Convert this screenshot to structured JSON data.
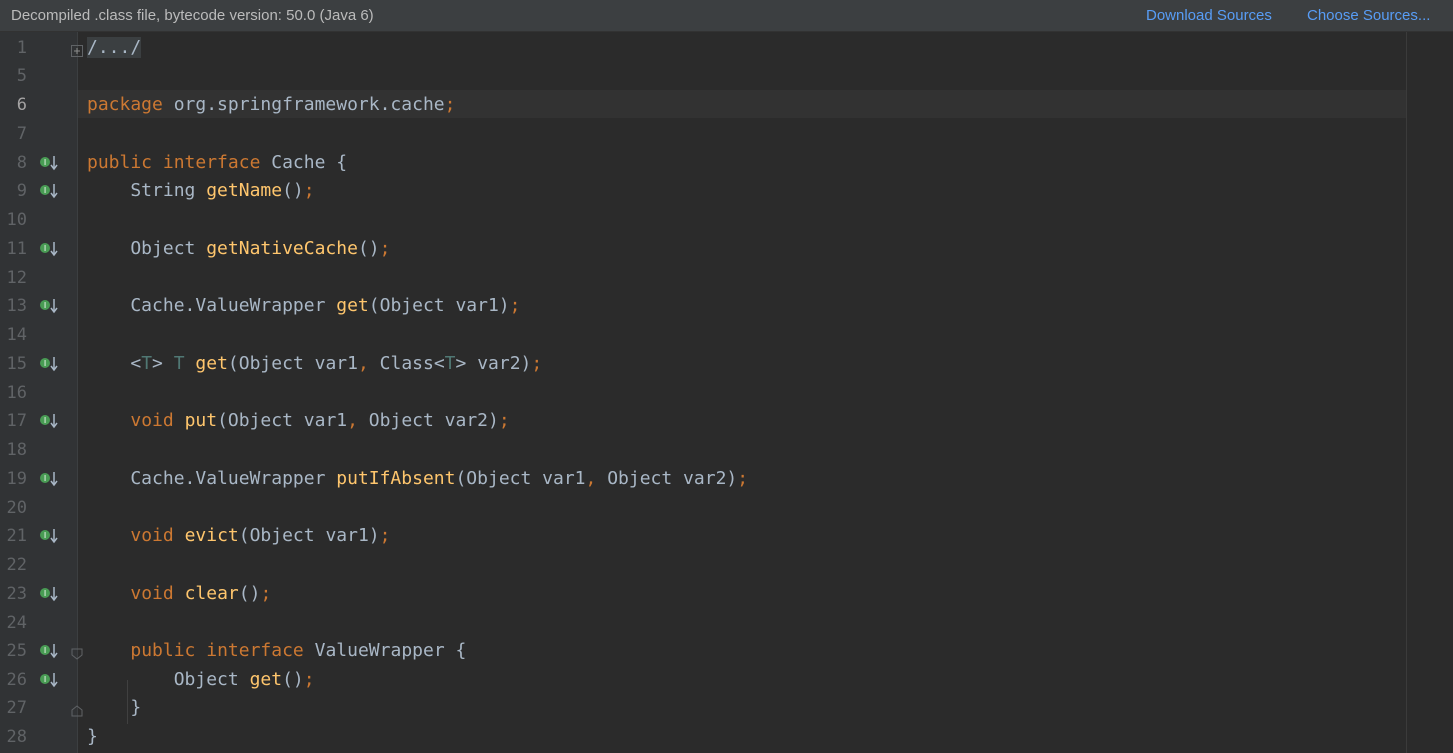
{
  "banner": {
    "text": "Decompiled .class file, bytecode version: 50.0 (Java 6)",
    "download_sources": "Download Sources",
    "choose_sources": "Choose Sources..."
  },
  "editor": {
    "current_line": "6",
    "lines": [
      {
        "num": "1",
        "folded": "/.../"
      },
      {
        "num": "5"
      },
      {
        "num": "6",
        "t1": "package",
        "t2": " org.springframework.cache",
        "t3": ";"
      },
      {
        "num": "7"
      },
      {
        "num": "8",
        "t1": "public",
        "t2": " ",
        "t3": "interface",
        "t4": " Cache {"
      },
      {
        "num": "9",
        "t1": "    String ",
        "t2": "getName",
        "t3": "()",
        "t4": ";"
      },
      {
        "num": "10"
      },
      {
        "num": "11",
        "t1": "    Object ",
        "t2": "getNativeCache",
        "t3": "()",
        "t4": ";"
      },
      {
        "num": "12"
      },
      {
        "num": "13",
        "t1": "    Cache.ValueWrapper ",
        "t2": "get",
        "t3": "(Object var1)",
        "t4": ";"
      },
      {
        "num": "14"
      },
      {
        "num": "15",
        "t1": "    <",
        "t2": "T",
        "t3": "> ",
        "t4": "T",
        "t5": " ",
        "t6": "get",
        "t7": "(Object var1",
        "t8": ",",
        "t9": " Class<",
        "t10": "T",
        "t11": "> var2)",
        "t12": ";"
      },
      {
        "num": "16"
      },
      {
        "num": "17",
        "t1": "    ",
        "t2": "void",
        "t3": " ",
        "t4": "put",
        "t5": "(Object var1",
        "t6": ",",
        "t7": " Object var2)",
        "t8": ";"
      },
      {
        "num": "18"
      },
      {
        "num": "19",
        "t1": "    Cache.ValueWrapper ",
        "t2": "putIfAbsent",
        "t3": "(Object var1",
        "t4": ",",
        "t5": " Object var2)",
        "t6": ";"
      },
      {
        "num": "20"
      },
      {
        "num": "21",
        "t1": "    ",
        "t2": "void",
        "t3": " ",
        "t4": "evict",
        "t5": "(Object var1)",
        "t6": ";"
      },
      {
        "num": "22"
      },
      {
        "num": "23",
        "t1": "    ",
        "t2": "void",
        "t3": " ",
        "t4": "clear",
        "t5": "()",
        "t6": ";"
      },
      {
        "num": "24"
      },
      {
        "num": "25",
        "t1": "    ",
        "t2": "public",
        "t3": " ",
        "t4": "interface",
        "t5": " ValueWrapper {"
      },
      {
        "num": "26",
        "t1": "        Object ",
        "t2": "get",
        "t3": "()",
        "t4": ";"
      },
      {
        "num": "27",
        "t1": "    }"
      },
      {
        "num": "28",
        "t1": "}"
      }
    ]
  },
  "icons": {
    "implemented_marker": "implemented-method-icon",
    "fold_marker": "fold-icon"
  },
  "colors": {
    "background": "#2b2b2b",
    "gutter": "#313335",
    "keyword": "#cc7832",
    "method": "#ffc66d",
    "text": "#a9b7c6",
    "type_param": "#507874",
    "link": "#589df6"
  }
}
